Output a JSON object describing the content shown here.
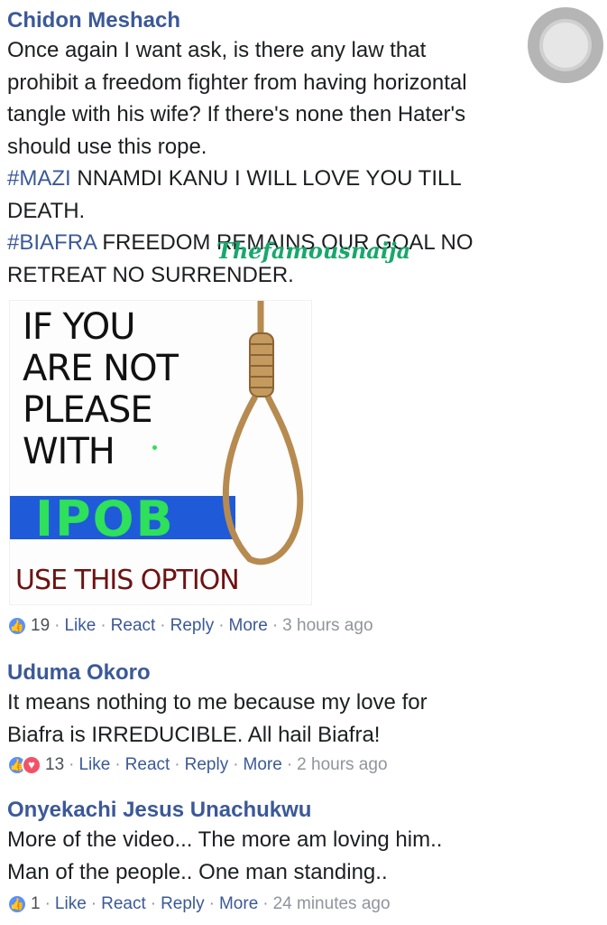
{
  "comments": [
    {
      "author": "Chidon Meshach",
      "text_lines": [
        "Once again I want ask, is there any law that",
        "prohibit a freedom fighter from having horizontal",
        "tangle with his wife? If there's none then Hater's",
        "should use this rope."
      ],
      "hashtag1": "#MAZI",
      "after_hashtag1": " NNAMDI KANU I WILL LOVE YOU TILL",
      "line_death": "DEATH.",
      "hashtag2": "#BIAFRA",
      "after_hashtag2": " FREEDOM REMAINS OUR GOAL NO",
      "line_last": "RETREAT NO SURRENDER.",
      "reaction_count": "19",
      "like": "Like",
      "react": "React",
      "reply": "Reply",
      "more": "More",
      "time": "3 hours ago"
    },
    {
      "author": "Uduma Okoro",
      "text_lines": [
        "It means nothing to me because my love for",
        "Biafra is IRREDUCIBLE. All hail Biafra!"
      ],
      "reaction_count": "13",
      "like": "Like",
      "react": "React",
      "reply": "Reply",
      "more": "More",
      "time": "2 hours ago"
    },
    {
      "author": "Onyekachi Jesus Unachukwu",
      "text_lines": [
        "More of the video... The more am loving him..",
        "Man of the people.. One man standing.."
      ],
      "reaction_count": "1",
      "like": "Like",
      "react": "React",
      "reply": "Reply",
      "more": "More",
      "time": "24 minutes ago"
    }
  ],
  "watermark": "Thefamousnaija",
  "meme": {
    "lines": [
      "IF YOU",
      "ARE NOT",
      "PLEASE",
      "WITH"
    ],
    "ipob": "IPOB",
    "bottom": "USE THIS OPTION"
  },
  "colors": {
    "author": "#3b5998",
    "hashtag": "#3b5998",
    "meta": "#90949c",
    "like_icon": "#5890ff",
    "love_icon": "#f25268"
  }
}
